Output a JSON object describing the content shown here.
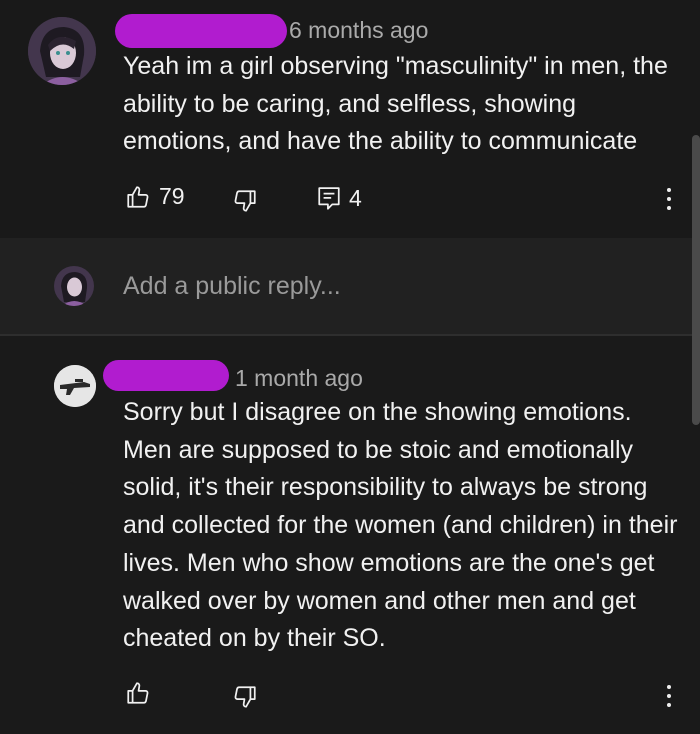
{
  "comments": [
    {
      "time": "6 months ago",
      "text": "Yeah im a girl observing \"masculinity\" in men, the ability to be caring, and selfless, showing emotions, and have the ability to communicate",
      "likes": "79",
      "replies": "4",
      "icons": {
        "like": "thumbs-up-icon",
        "dislike": "thumbs-down-icon",
        "reply": "comment-icon",
        "menu": "more-vert-icon"
      }
    },
    {
      "time": "1 month ago",
      "text": "Sorry but I disagree on the showing emotions. Men are supposed to be stoic and emotionally solid, it's their responsibility to always be strong and collected for the women (and children) in their lives.  Men who show emotions are the one's get walked over by women and other men and get cheated on by their SO.",
      "icons": {
        "like": "thumbs-up-icon",
        "dislike": "thumbs-down-icon",
        "menu": "more-vert-icon"
      }
    }
  ],
  "reply_box": {
    "placeholder": "Add a public reply..."
  },
  "colors": {
    "redaction": "#b11ccf",
    "background": "#181818",
    "text": "#f1f1f1",
    "muted": "#aaaaaa"
  }
}
